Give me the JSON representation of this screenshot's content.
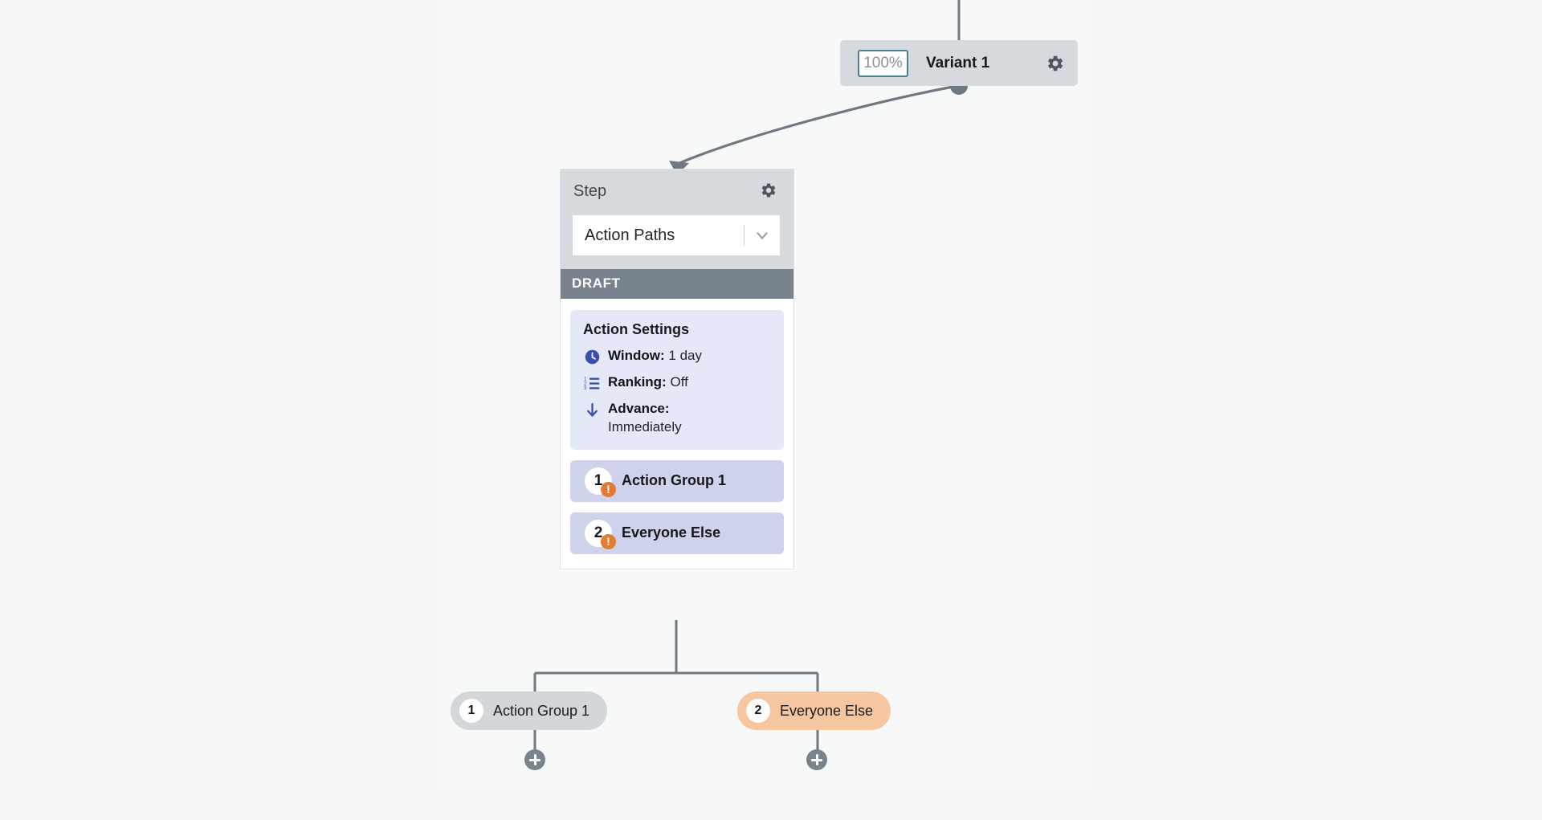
{
  "canvas": {
    "background": "#f7f9f9",
    "page_background": "#f4f6f6"
  },
  "variant_card": {
    "percent_value": "100%",
    "percent_placeholder": "100%",
    "name": "Variant 1",
    "settings_icon": "gear-icon",
    "background": "#d6dade",
    "input_border": "#4c7f92"
  },
  "step_card": {
    "title": "Step",
    "settings_icon": "gear-icon",
    "select": {
      "value": "Action Paths",
      "chevron_icon": "chevron-down-icon"
    },
    "status_badge": "DRAFT",
    "status_color": "#78838e",
    "settings": {
      "title": "Action Settings",
      "rows": [
        {
          "icon": "clock-icon",
          "label": "Window:",
          "value": "1 day"
        },
        {
          "icon": "ordered-list-icon",
          "label": "Ranking:",
          "value": "Off"
        },
        {
          "icon": "arrow-down-icon",
          "label": "Advance:",
          "value": "Immediately"
        }
      ],
      "accent": "#3b4fa8",
      "background": "#e5e8f6"
    },
    "groups": [
      {
        "number": "1",
        "label": "Action Group 1",
        "warning_icon": "warning-icon",
        "warning_glyph": "!"
      },
      {
        "number": "2",
        "label": "Everyone Else",
        "warning_icon": "warning-icon",
        "warning_glyph": "!"
      }
    ],
    "group_background": "#ced2ea",
    "warning_color": "#e17c35"
  },
  "branches": [
    {
      "number": "1",
      "label": "Action Group 1",
      "color": "#d3d7da",
      "add_icon": "plus-circle-icon"
    },
    {
      "number": "2",
      "label": "Everyone Else",
      "color": "#f5c6a0",
      "add_icon": "plus-circle-icon"
    }
  ],
  "connectors": {
    "color": "#6d7880"
  }
}
